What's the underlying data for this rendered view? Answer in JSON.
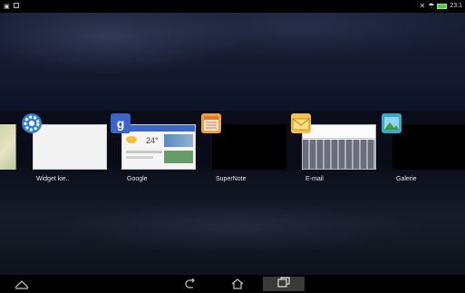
{
  "status_bar": {
    "left_icons": [
      "notification-icon",
      "screenshot-icon"
    ],
    "right_icons": [
      "mute-icon",
      "wifi-icon",
      "battery-icon"
    ],
    "time": "23:1"
  },
  "recent_apps": [
    {
      "label": "Widget kie..",
      "icon": "gear-icon"
    },
    {
      "label": "Google",
      "icon": "google-icon"
    },
    {
      "label": "SuperNote",
      "icon": "notebook-icon"
    },
    {
      "label": "E-mail",
      "icon": "envelope-icon"
    },
    {
      "label": "Galerie",
      "icon": "picture-icon"
    }
  ],
  "google_thumb": {
    "temperature": "24°"
  },
  "nav": {
    "buttons": [
      "menu-icon",
      "back-icon",
      "home-icon",
      "recents-icon"
    ]
  },
  "colors": {
    "battery": "#4ccf3a",
    "settings_blue": "#2f7fd0",
    "google_blue": "#3b66c8",
    "supernote_orange": "#f0a040",
    "email_yellow": "#f2c24a",
    "gallery_teal": "#3aa9c9"
  }
}
